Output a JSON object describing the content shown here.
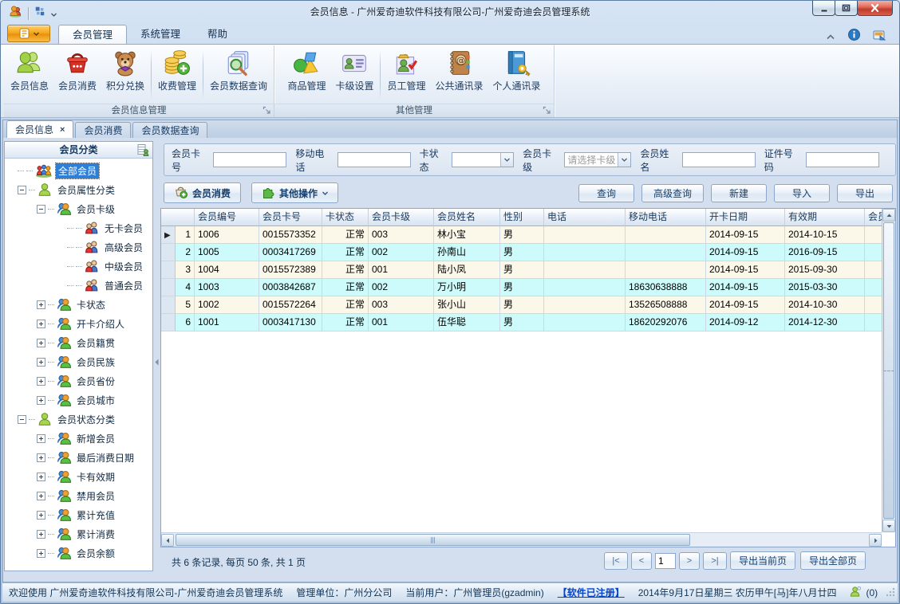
{
  "window": {
    "title": "会员信息 - 广州爱奇迪软件科技有限公司-广州爱奇迪会员管理系统"
  },
  "ribbon_tabs": [
    {
      "label": "会员管理",
      "active": true
    },
    {
      "label": "系统管理",
      "active": false
    },
    {
      "label": "帮助",
      "active": false
    }
  ],
  "ribbon_groups": [
    {
      "label": "会员信息管理",
      "items": [
        {
          "label": "会员信息",
          "icon": "member-info-icon"
        },
        {
          "label": "会员消费",
          "icon": "member-consume-icon"
        },
        {
          "label": "积分兑换",
          "icon": "points-exchange-icon"
        },
        {
          "type": "sep"
        },
        {
          "label": "收费管理",
          "icon": "fee-management-icon"
        },
        {
          "type": "sep"
        },
        {
          "label": "会员数据查询",
          "icon": "member-data-query-icon"
        }
      ]
    },
    {
      "label": "其他管理",
      "items": [
        {
          "label": "商品管理",
          "icon": "goods-management-icon"
        },
        {
          "label": "卡级设置",
          "icon": "card-level-icon"
        },
        {
          "type": "sep"
        },
        {
          "label": "员工管理",
          "icon": "staff-management-icon"
        },
        {
          "label": "公共通讯录",
          "icon": "public-contacts-icon"
        },
        {
          "label": "个人通讯录",
          "icon": "personal-contacts-icon"
        }
      ]
    }
  ],
  "doc_tabs": [
    {
      "label": "会员信息",
      "active": true,
      "closable": true
    },
    {
      "label": "会员消费",
      "active": false,
      "closable": false
    },
    {
      "label": "会员数据查询",
      "active": false,
      "closable": false
    }
  ],
  "sidebar": {
    "header": "会员分类",
    "tree": [
      {
        "label": "全部会员",
        "level": 0,
        "icon": "all-members-icon",
        "selected": true,
        "expander": "none"
      },
      {
        "label": "会员属性分类",
        "level": 0,
        "icon": "member-group-icon",
        "selected": false,
        "expander": "minus"
      },
      {
        "label": "会员卡级",
        "level": 1,
        "icon": "category-people-icon",
        "selected": false,
        "expander": "minus"
      },
      {
        "label": "无卡会员",
        "level": 2,
        "icon": "member-pair-icon",
        "selected": false,
        "expander": "none"
      },
      {
        "label": "高级会员",
        "level": 2,
        "icon": "member-pair-icon",
        "selected": false,
        "expander": "none"
      },
      {
        "label": "中级会员",
        "level": 2,
        "icon": "member-pair-icon",
        "selected": false,
        "expander": "none"
      },
      {
        "label": "普通会员",
        "level": 2,
        "icon": "member-pair-icon",
        "selected": false,
        "expander": "none"
      },
      {
        "label": "卡状态",
        "level": 1,
        "icon": "category-people-icon",
        "selected": false,
        "expander": "plus"
      },
      {
        "label": "开卡介绍人",
        "level": 1,
        "icon": "category-people-icon",
        "selected": false,
        "expander": "plus"
      },
      {
        "label": "会员籍贯",
        "level": 1,
        "icon": "category-people-icon",
        "selected": false,
        "expander": "plus"
      },
      {
        "label": "会员民族",
        "level": 1,
        "icon": "category-people-icon",
        "selected": false,
        "expander": "plus"
      },
      {
        "label": "会员省份",
        "level": 1,
        "icon": "category-people-icon",
        "selected": false,
        "expander": "plus"
      },
      {
        "label": "会员城市",
        "level": 1,
        "icon": "category-people-icon",
        "selected": false,
        "expander": "plus"
      },
      {
        "label": "会员状态分类",
        "level": 0,
        "icon": "member-group-icon",
        "selected": false,
        "expander": "minus"
      },
      {
        "label": "新增会员",
        "level": 1,
        "icon": "category-people-icon",
        "selected": false,
        "expander": "plus"
      },
      {
        "label": "最后消费日期",
        "level": 1,
        "icon": "category-people-icon",
        "selected": false,
        "expander": "plus"
      },
      {
        "label": "卡有效期",
        "level": 1,
        "icon": "category-people-icon",
        "selected": false,
        "expander": "plus"
      },
      {
        "label": "禁用会员",
        "level": 1,
        "icon": "category-people-icon",
        "selected": false,
        "expander": "plus"
      },
      {
        "label": "累计充值",
        "level": 1,
        "icon": "category-people-icon",
        "selected": false,
        "expander": "plus"
      },
      {
        "label": "累计消费",
        "level": 1,
        "icon": "category-people-icon",
        "selected": false,
        "expander": "plus"
      },
      {
        "label": "会员余额",
        "level": 1,
        "icon": "category-people-icon",
        "selected": false,
        "expander": "plus"
      }
    ]
  },
  "search_fields": [
    {
      "label": "会员卡号",
      "type": "text",
      "value": ""
    },
    {
      "label": "移动电话",
      "type": "text",
      "value": ""
    },
    {
      "label": "卡状态",
      "type": "select",
      "value": "",
      "placeholder": ""
    },
    {
      "label": "会员卡级",
      "type": "select",
      "value": "",
      "placeholder": "请选择卡级"
    },
    {
      "label": "会员姓名",
      "type": "text",
      "value": ""
    },
    {
      "label": "证件号码",
      "type": "text",
      "value": ""
    }
  ],
  "toolbar": {
    "consume_button": "会员消费",
    "other_ops_button": "其他操作",
    "actions": [
      "查询",
      "高级查询",
      "新建",
      "导入",
      "导出"
    ]
  },
  "grid": {
    "columns": [
      "会员编号",
      "会员卡号",
      "卡状态",
      "会员卡级",
      "会员姓名",
      "性别",
      "电话",
      "移动电话",
      "开卡日期",
      "有效期",
      "会员"
    ],
    "rows": [
      [
        "1006",
        "0015573352",
        "正常",
        "003",
        "林小宝",
        "男",
        "",
        "",
        "2014-09-15",
        "2014-10-15",
        ""
      ],
      [
        "1005",
        "0003417269",
        "正常",
        "002",
        "孙南山",
        "男",
        "",
        "",
        "2014-09-15",
        "2016-09-15",
        ""
      ],
      [
        "1004",
        "0015572389",
        "正常",
        "001",
        "陆小凤",
        "男",
        "",
        "",
        "2014-09-15",
        "2015-09-30",
        ""
      ],
      [
        "1003",
        "0003842687",
        "正常",
        "002",
        "万小明",
        "男",
        "",
        "18630638888",
        "2014-09-15",
        "2015-03-30",
        ""
      ],
      [
        "1002",
        "0015572264",
        "正常",
        "003",
        "张小山",
        "男",
        "",
        "13526508888",
        "2014-09-15",
        "2014-10-30",
        ""
      ],
      [
        "1001",
        "0003417130",
        "正常",
        "001",
        "伍华聪",
        "男",
        "",
        "18620292076",
        "2014-09-12",
        "2014-12-30",
        ""
      ]
    ]
  },
  "pager": {
    "summary": "共 6 条记录, 每页 50 条, 共 1 页",
    "first": "|<",
    "prev": "<",
    "page": "1",
    "next": ">",
    "last": ">|",
    "export_current": "导出当前页",
    "export_all": "导出全部页"
  },
  "statusbar": {
    "welcome": "欢迎使用 广州爱奇迪软件科技有限公司-广州爱奇迪会员管理系统",
    "org": "管理单位：广州分公司",
    "user": "当前用户：广州管理员(gzadmin)",
    "registered": "【软件已注册】",
    "datetime": "2014年9月17日星期三 农历甲午[马]年八月廿四",
    "msg_count": "(0)"
  }
}
